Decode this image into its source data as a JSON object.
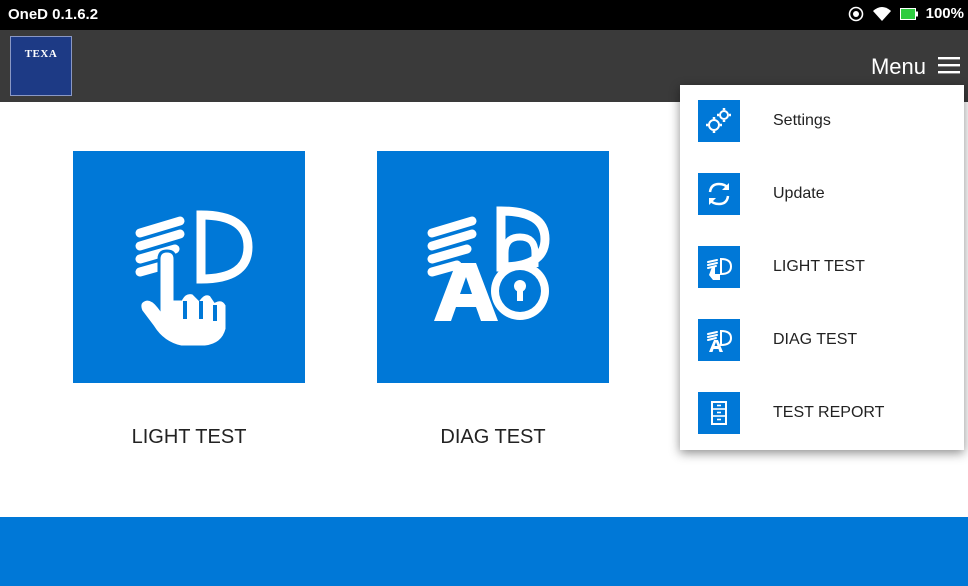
{
  "status_bar": {
    "title": "OneD 0.1.6.2",
    "battery": "100%"
  },
  "app_bar": {
    "logo_text": "TEXA",
    "menu_label": "Menu"
  },
  "tiles": [
    {
      "label": "LIGHT TEST",
      "icon": "light-test-icon"
    },
    {
      "label": "DIAG TEST",
      "icon": "diag-test-icon"
    }
  ],
  "menu": {
    "items": [
      {
        "label": "Settings",
        "icon": "gears-icon"
      },
      {
        "label": "Update",
        "icon": "refresh-icon"
      },
      {
        "label": "LIGHT TEST",
        "icon": "light-test-icon"
      },
      {
        "label": "DIAG TEST",
        "icon": "diag-test-icon"
      },
      {
        "label": "TEST REPORT",
        "icon": "report-icon"
      }
    ]
  },
  "colors": {
    "accent": "#0078d7",
    "app_bar": "#3a3a3a",
    "status_bar": "#000000",
    "logo_bg": "#1d3a85"
  }
}
